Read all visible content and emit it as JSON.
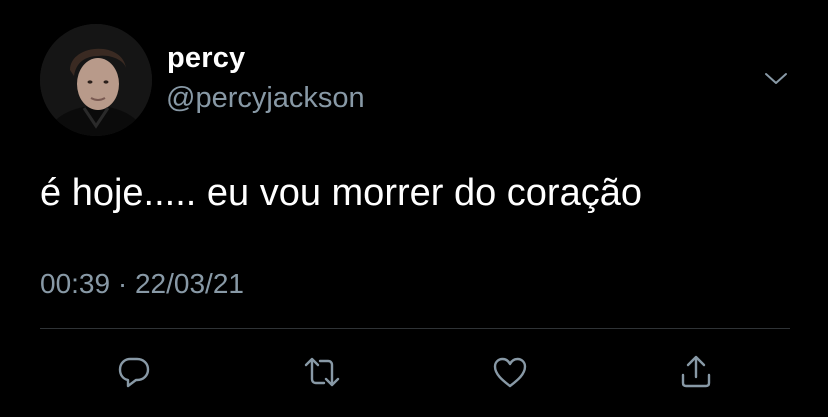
{
  "user": {
    "display_name": "percy",
    "handle": "@percyjackson"
  },
  "tweet": {
    "text": "é hoje..... eu vou morrer do coração",
    "time": "00:39",
    "separator": "·",
    "date": "22/03/21"
  },
  "actions": [
    {
      "icon": "reply-icon"
    },
    {
      "icon": "retweet-icon"
    },
    {
      "icon": "like-icon"
    },
    {
      "icon": "share-icon"
    }
  ],
  "colors": {
    "background": "#000000",
    "primary_text": "#ffffff",
    "secondary_text": "#8899a6",
    "divider": "#2f3336"
  }
}
